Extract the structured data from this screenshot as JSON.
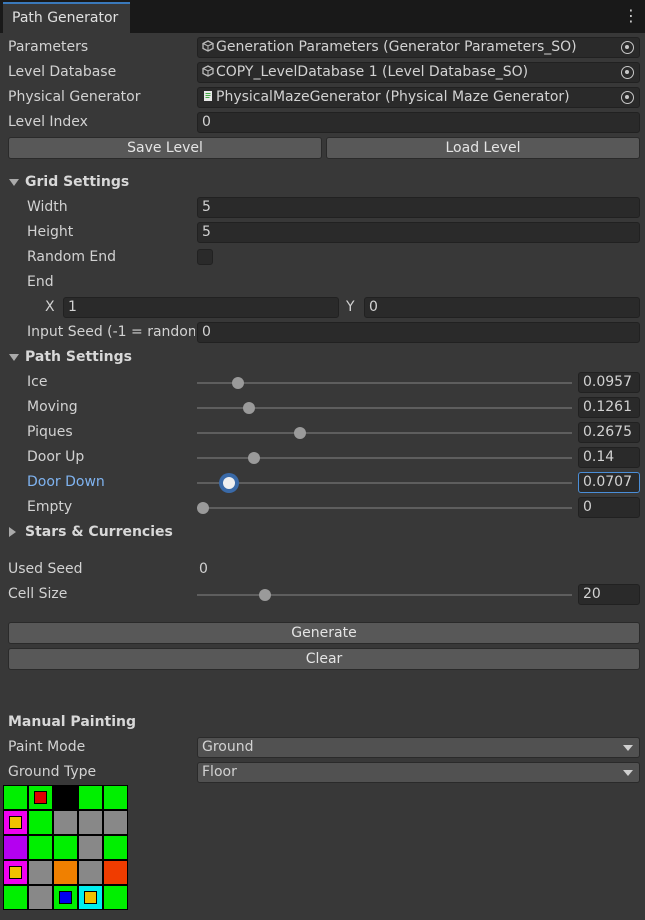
{
  "tab": {
    "title": "Path Generator",
    "menu_icon": "kebab-menu-icon"
  },
  "references": [
    {
      "label": "Parameters",
      "value": "Generation Parameters (Generator Parameters_SO)",
      "icon": "scriptable-object-icon"
    },
    {
      "label": "Level Database",
      "value": "COPY_LevelDatabase 1 (Level Database_SO)",
      "icon": "scriptable-object-icon"
    },
    {
      "label": "Physical Generator",
      "value": "PhysicalMazeGenerator (Physical Maze Generator)",
      "icon": "script-icon"
    }
  ],
  "level_index": {
    "label": "Level Index",
    "value": "0"
  },
  "buttons": {
    "save": "Save Level",
    "load": "Load Level",
    "generate": "Generate",
    "clear": "Clear"
  },
  "grid_settings": {
    "title": "Grid Settings",
    "width": {
      "label": "Width",
      "value": "5"
    },
    "height": {
      "label": "Height",
      "value": "5"
    },
    "random_end": {
      "label": "Random End",
      "checked": false
    },
    "end": {
      "label": "End",
      "x_label": "X",
      "x": "1",
      "y_label": "Y",
      "y": "0"
    },
    "input_seed": {
      "label": "Input Seed (-1 = random",
      "value": "0"
    }
  },
  "path_settings": {
    "title": "Path Settings",
    "sliders": [
      {
        "label": "Ice",
        "value": "0.0957",
        "fraction": 0.0957,
        "active": false
      },
      {
        "label": "Moving",
        "value": "0.1261",
        "fraction": 0.1261,
        "active": false
      },
      {
        "label": "Piques",
        "value": "0.2675",
        "fraction": 0.2675,
        "active": false
      },
      {
        "label": "Door Up",
        "value": "0.14",
        "fraction": 0.14,
        "active": false
      },
      {
        "label": "Door Down",
        "value": "0.0707",
        "fraction": 0.0707,
        "active": true
      },
      {
        "label": "Empty",
        "value": "0",
        "fraction": 0,
        "active": false
      }
    ]
  },
  "stars": {
    "title": "Stars & Currencies"
  },
  "used_seed": {
    "label": "Used Seed",
    "value": "0"
  },
  "cell_size": {
    "label": "Cell Size",
    "value": "20",
    "fraction": 0.17
  },
  "manual_painting": {
    "title": "Manual Painting",
    "paint_mode": {
      "label": "Paint Mode",
      "value": "Ground"
    },
    "ground_type": {
      "label": "Ground Type",
      "value": "Floor"
    }
  },
  "colors": {
    "green": "#00f000",
    "black": "#000000",
    "gray": "#888888",
    "purple": "#b400f0",
    "orange": "#f08000",
    "red_orange": "#f03c00",
    "cyan": "#00f0f0",
    "red": "#e00000",
    "yellow": "#f0c000",
    "magenta": "#f000f0",
    "blue": "#0000f0"
  },
  "paint_grid": [
    [
      {
        "bg": "green"
      },
      {
        "bg": "green",
        "mark": "red"
      },
      {
        "bg": "black"
      },
      {
        "bg": "green"
      },
      {
        "bg": "green"
      }
    ],
    [
      {
        "bg": "magenta",
        "mark": "yellow"
      },
      {
        "bg": "green"
      },
      {
        "bg": "gray"
      },
      {
        "bg": "gray"
      },
      {
        "bg": "gray"
      }
    ],
    [
      {
        "bg": "purple"
      },
      {
        "bg": "green"
      },
      {
        "bg": "green"
      },
      {
        "bg": "gray"
      },
      {
        "bg": "green"
      }
    ],
    [
      {
        "bg": "magenta",
        "mark": "yellow"
      },
      {
        "bg": "gray"
      },
      {
        "bg": "orange"
      },
      {
        "bg": "gray"
      },
      {
        "bg": "red_orange"
      }
    ],
    [
      {
        "bg": "green"
      },
      {
        "bg": "gray"
      },
      {
        "bg": "green",
        "mark": "blue"
      },
      {
        "bg": "cyan",
        "mark": "yellow"
      },
      {
        "bg": "green"
      }
    ]
  ]
}
